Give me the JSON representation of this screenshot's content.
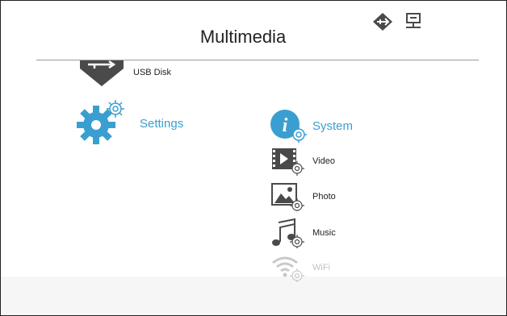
{
  "header": {
    "title": "Multimedia",
    "status_icons": [
      "usb-connection-icon",
      "network-icon"
    ]
  },
  "menu": {
    "left": [
      {
        "id": "usb-disk",
        "label": "USB Disk",
        "icon": "usb-disk-icon"
      },
      {
        "id": "settings",
        "label": "Settings",
        "icon": "settings-gear-icon",
        "selected": true
      }
    ],
    "right": {
      "section": {
        "label": "System",
        "icon": "system-info-icon"
      },
      "items": [
        {
          "id": "video",
          "label": "Video",
          "icon": "video-settings-icon"
        },
        {
          "id": "photo",
          "label": "Photo",
          "icon": "photo-settings-icon"
        },
        {
          "id": "music",
          "label": "Music",
          "icon": "music-settings-icon"
        },
        {
          "id": "wifi",
          "label": "WiFi",
          "icon": "wifi-settings-icon",
          "disabled": true
        }
      ]
    }
  },
  "colors": {
    "accent": "#3a9fd0",
    "icon_dark": "#4a4a4a",
    "divider": "#9a9a9a"
  }
}
